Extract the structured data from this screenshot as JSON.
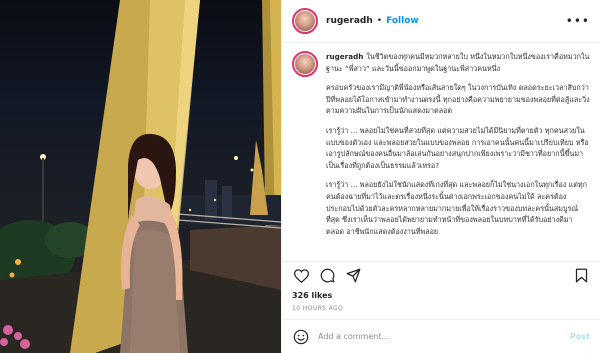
{
  "header": {
    "username": "rugeradh",
    "separator": "•",
    "follow_label": "Follow",
    "more_label": "•••"
  },
  "caption": {
    "author": "rugeradh",
    "paragraphs": [
      "ในชีวิตของทุกคนมีหมวกหลายใบ หนึ่งในหมวกใบหนึ่งของเราคือหมวกในฐานะ “พี่สาว” และวันนี้ขออกมาพูดในฐานะพี่สาวคนหนึ่ง",
      "ครอบครัวของเรามีญาติพี่น้องหรือเส้นสายใดๆ ในวงการบันเทิง ตลอดระยะเวลาสิบกว่าปีที่พลอยได้โอกาสเข้ามาทำงานตรงนี้ ทุกอย่างคือความพยายามของพลอยที่ต่อสู้และวิ่งตามความฝันในการเป็นนักแสดงมาตลอด",
      "เรารู้ว่า ... พลอยไม่ใช่คนที่สวยที่สุด แต่ความสวยไม่ได้มีนิยามที่ตายตัว ทุกคนสวยในแบบของตัวเอง และพลอยสวยในแบบของพลอย การเอาคนนั้นคนนี้มาเปรียบเทียบ หรือเอารูปลักษณ์ของคนอื่นมาล้อเล่นกันอย่างสนุกปากเพียงเพราะว่ามีชาวที่อยากนี้ขึ้นมา เป็นเรื่องที่ถูกต้องเป็นธรรมแล้วเหรอ?",
      "เรารู้ว่า ... พลอยยังไม่ใช่นักแสดงที่เก่งที่สุด และพลอยก็ไม่ใช่นางเอกในทุกเรื่อง แต่ทุกคนต้องฉายที่มาไว้และตรเรื่องหนึ่งระนิ้นต่างเอกพระเอกของคนไม่ใด้ ละครต้องประกอบไปด้วยตัวละครหลากหลายมากมายเพื่อให้เรื่องราวของบทละครนั้นสมบูรณ์ที่สุด ซึ่งเราเห็นว่าพลอยได้พยายามทำหน้าที่ของพลอยในบทบาทที่ได้รับอย่างดีมาตลอด อาชีพนักแสดงต้องงานที่พลอย"
    ]
  },
  "actions": {
    "like_icon": "heart-icon",
    "comment_icon": "comment-bubble-icon",
    "share_icon": "paper-plane-icon",
    "save_icon": "bookmark-icon"
  },
  "likes_text": "326 likes",
  "timestamp": "10 HOURS AGO",
  "comment_box": {
    "placeholder": "Add a comment...",
    "post_label": "Post"
  },
  "colors": {
    "follow_blue": "#0095f6",
    "post_disabled": "#b2dffc",
    "story_ring": "#e1306c"
  }
}
